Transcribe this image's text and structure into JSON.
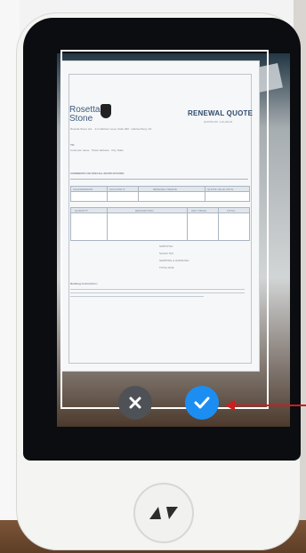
{
  "document": {
    "logo_text_line1": "Rosetta",
    "logo_text_line2": "Stone",
    "title": "RENEWAL QUOTE",
    "subtitle": "QUOTE NO. 1-FLAR-01",
    "from_address": "Rosetta Stone Ltd. · 1-2 Harrison Loop, Suite 400 · Harrisonburg, VA",
    "to_label": "TO:",
    "to_address": "Customer name · Street address · City, State",
    "comments_label": "COMMENTS OR SPECIAL INSTRUCTIONS:",
    "table1_headers": [
      "SALESPERSON",
      "ACCOUNT #",
      "RENEWAL PERIOD",
      "QUOTE VALID UNTIL"
    ],
    "table2_headers": [
      "QUANTITY",
      "DESCRIPTION",
      "UNIT PRICE",
      "TOTAL"
    ],
    "totals_labels": [
      "SUBTOTAL",
      "SALES TAX",
      "SHIPPING & HANDLING",
      "TOTAL DUE"
    ],
    "footer_label": "Banking instructions:"
  },
  "controls": {
    "cancel_icon": "close-icon",
    "confirm_icon": "check-icon",
    "home_icon": "translate-arrows-icon"
  },
  "annotation": {
    "arrow_color": "#d11c1c"
  },
  "colors": {
    "confirm_blue": "#1c8ef2",
    "cancel_gray": "#4e5256"
  }
}
